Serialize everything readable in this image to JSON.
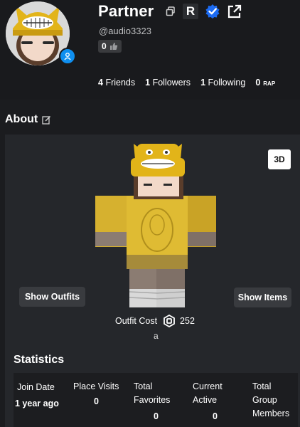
{
  "profile": {
    "display_name": "Partner",
    "username": "@audio3323",
    "rating_count": "0",
    "badge_letter": "R"
  },
  "counts": {
    "friends_value": "4",
    "friends_label": "Friends",
    "followers_value": "1",
    "followers_label": "Followers",
    "following_value": "1",
    "following_label": "Following",
    "rap_value": "0",
    "rap_label": "RAP"
  },
  "about": {
    "title": "About",
    "view_3d_label": "3D",
    "show_outfits_label": "Show Outfits",
    "show_items_label": "Show Items",
    "outfit_cost_label": "Outfit Cost",
    "outfit_cost_value": "252",
    "outfit_name": "a"
  },
  "statistics": {
    "title": "Statistics",
    "join_date_label": "Join Date",
    "join_date_value": "1 year ago",
    "place_visits_label": "Place Visits",
    "place_visits_value": "0",
    "total_favorites_label": "Total Favorites",
    "total_favorites_value": "0",
    "current_active_label": "Current Active",
    "current_active_value": "0",
    "total_group_members_label": "Total Group Members"
  },
  "colors": {
    "background": "#1b1c1f",
    "card": "#25272b",
    "accent_blue": "#0f8ff0",
    "hat_yellow": "#e2b419",
    "shirt_yellow": "#d7b32f"
  },
  "icons": [
    "person-icon",
    "copy-icon",
    "verified-badge-icon",
    "share-icon",
    "thumbs-up-icon",
    "edit-icon",
    "robux-icon"
  ]
}
